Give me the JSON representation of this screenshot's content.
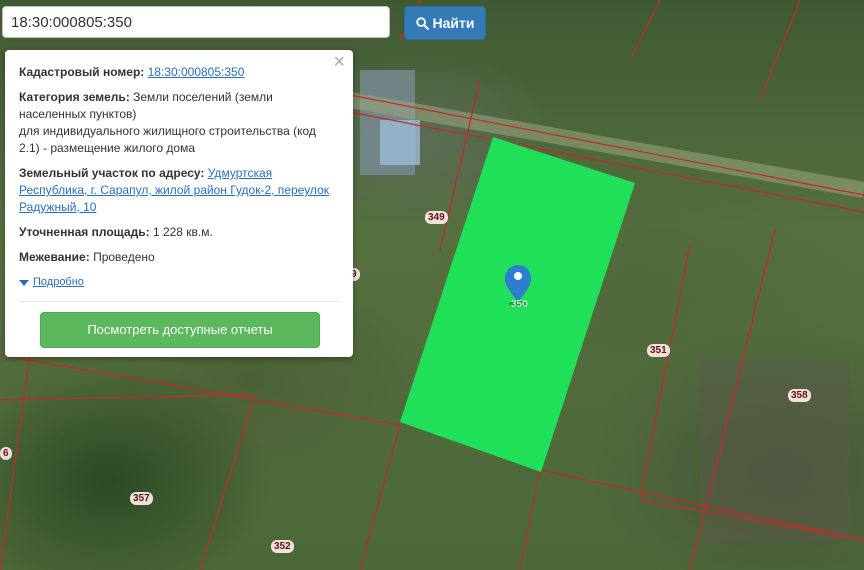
{
  "search": {
    "value": "18:30:000805:350",
    "button_label": "Найти"
  },
  "popup": {
    "cadastral_label": "Кадастровый номер:",
    "cadastral_value": "18:30:000805:350",
    "category_label": "Категория земель:",
    "category_value": "Земли поселений (земли населенных пунктов)",
    "category_use": "для индивидуального жилищного строительства (код 2.1) - размещение жилого дома",
    "address_label": "Земельный участок по адресу:",
    "address_value": "Удмуртская Республика, г. Сарапул, жилой район Гудок-2, переулок Радужный, 10",
    "area_label": "Уточненная площадь:",
    "area_value": "1 228 кв.м.",
    "survey_label": "Межевание:",
    "survey_value": "Проведено",
    "more_link": "Подробно",
    "report_button": "Посмотреть доступные отчеты"
  },
  "parcel_labels": [
    "349",
    "351",
    "358",
    "357",
    "352",
    "350",
    "6",
    "9"
  ],
  "colors": {
    "parcel_fill": "#1ee65a",
    "boundary": "#d22a2a",
    "button_blue": "#337ab7",
    "button_green": "#5cb85c"
  }
}
